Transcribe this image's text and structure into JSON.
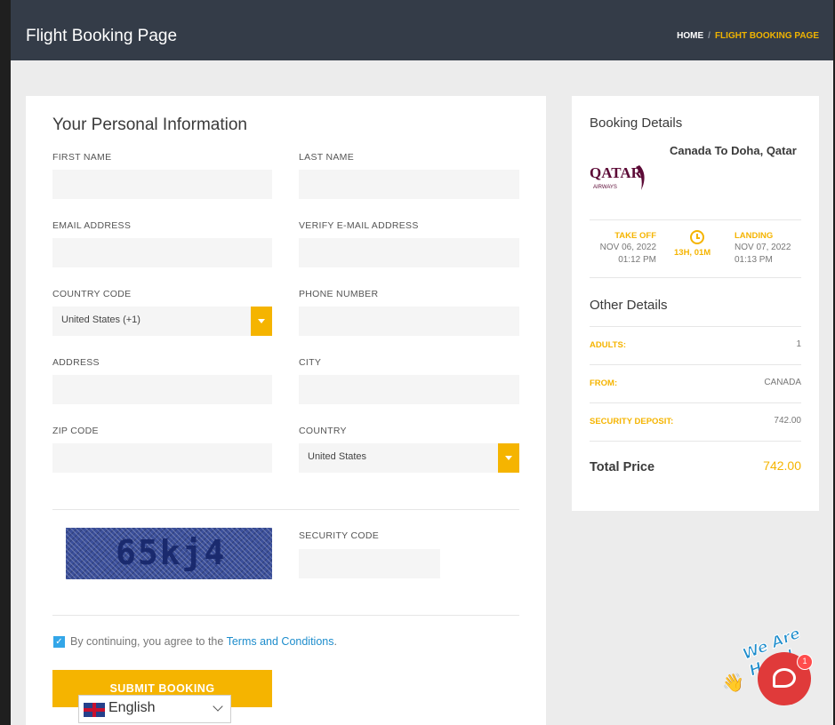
{
  "header": {
    "title": "Flight Booking Page",
    "breadcrumb": {
      "home": "HOME",
      "separator": "/",
      "current": "FLIGHT BOOKING PAGE"
    }
  },
  "form": {
    "heading": "Your Personal Information",
    "first_name_label": "FIRST NAME",
    "last_name_label": "LAST NAME",
    "email_label": "EMAIL ADDRESS",
    "verify_email_label": "VERIFY E-MAIL ADDRESS",
    "country_code_label": "COUNTRY CODE",
    "country_code_value": "United States (+1)",
    "phone_label": "PHONE NUMBER",
    "address_label": "ADDRESS",
    "city_label": "CITY",
    "zip_label": "ZIP CODE",
    "country_label": "COUNTRY",
    "country_value": "United States",
    "captcha_text": "65kj4",
    "security_code_label": "SECURITY CODE",
    "agree_prefix": "By continuing, you agree to the ",
    "agree_link": "Terms and Conditions",
    "agree_suffix": ".",
    "agree_checked": true,
    "submit_label": "SUBMIT BOOKING"
  },
  "booking": {
    "heading": "Booking Details",
    "airline_logo_text": "QATAR",
    "airline_logo_sub": "AIRWAYS",
    "route": "Canada To Doha, Qatar",
    "takeoff_label": "TAKE OFF",
    "takeoff_date": "NOV 06, 2022",
    "takeoff_time": "01:12 PM",
    "duration": "13H, 01M",
    "landing_label": "LANDING",
    "landing_date": "NOV 07, 2022",
    "landing_time": "01:13 PM"
  },
  "other": {
    "heading": "Other Details",
    "rows": [
      {
        "key": "ADULTS:",
        "value": "1"
      },
      {
        "key": "FROM:",
        "value": "CANADA"
      },
      {
        "key": "SECURITY DEPOSIT:",
        "value": "742.00"
      }
    ],
    "total_label": "Total Price",
    "total_value": "742.00"
  },
  "language": {
    "code": "en",
    "name": "English"
  },
  "chat": {
    "badge_count": "1",
    "banner": "We Are Here!"
  },
  "colors": {
    "accent": "#f5b400",
    "header_bg": "#343c48",
    "link": "#1e8dcc"
  }
}
